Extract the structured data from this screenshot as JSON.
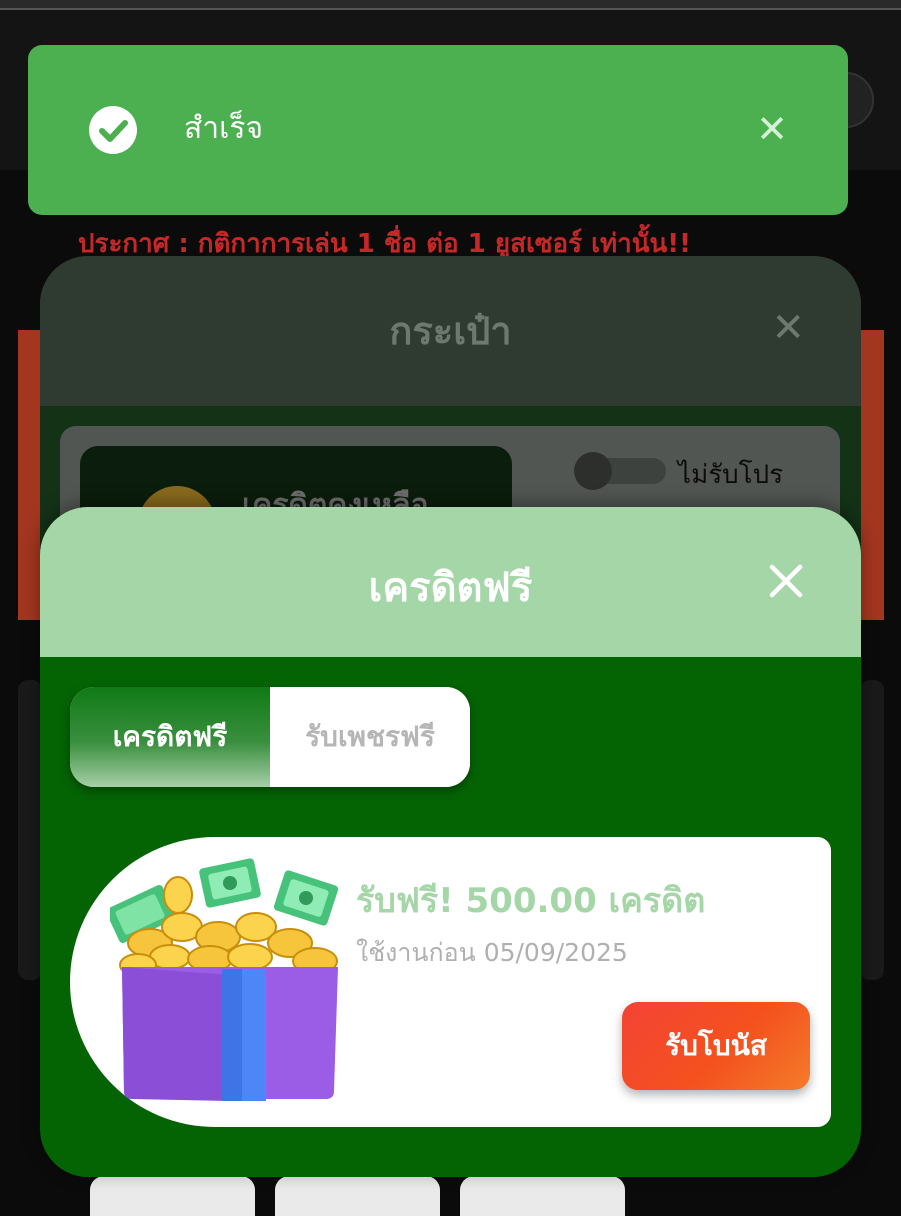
{
  "background": {
    "announcement": "ประกาศ : กติกาการเล่น 1 ชื่อ ต่อ 1 ยูสเซอร์ เท่านั้น!!"
  },
  "wallet_modal": {
    "title": "กระเป๋า",
    "close_symbol": "✕",
    "credit_label": "เครดิตคงเหลือ",
    "toggle_label": "ไม่รับโปร"
  },
  "toast": {
    "message": "สำเร็จ",
    "close_symbol": "✕",
    "icon": "check-circle-icon",
    "color": "#4caf50"
  },
  "free_credit_modal": {
    "title": "เครดิตฟรี",
    "close_icon": "close-icon",
    "tabs": [
      {
        "label": "เครดิตฟรี",
        "active": true
      },
      {
        "label": "รับเพชรฟรี",
        "active": false
      }
    ],
    "bonus": {
      "title": "รับฟรี! 500.00 เครดิต",
      "expiry": "ใช้งานก่อน 05/09/2025",
      "button_label": "รับโบนัส",
      "icon": "gift-box-icon"
    }
  },
  "colors": {
    "header_green": "#a5d6a7",
    "body_green": "#046404",
    "button_orange": "#f4511e"
  }
}
